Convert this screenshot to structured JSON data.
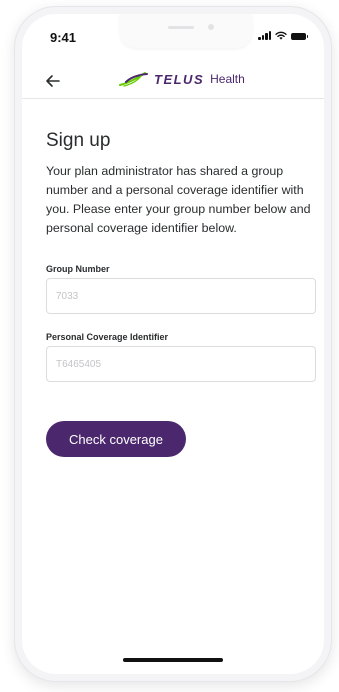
{
  "status_bar": {
    "time": "9:41"
  },
  "app_bar": {
    "back_icon": "arrow-left-icon",
    "brand_name": "TELUS",
    "brand_sub": "Health",
    "brand_color": "#4B286D"
  },
  "signup": {
    "title": "Sign up",
    "description": "Your plan administrator has shared a group number and a personal coverage identifier with you. Please enter your group number below and personal coverage identifier below.",
    "group_number": {
      "label": "Group Number",
      "value": "",
      "placeholder": "7033"
    },
    "coverage_id": {
      "label": "Personal Coverage Identifier",
      "value": "",
      "placeholder": "T6465405"
    },
    "submit_label": "Check coverage"
  }
}
